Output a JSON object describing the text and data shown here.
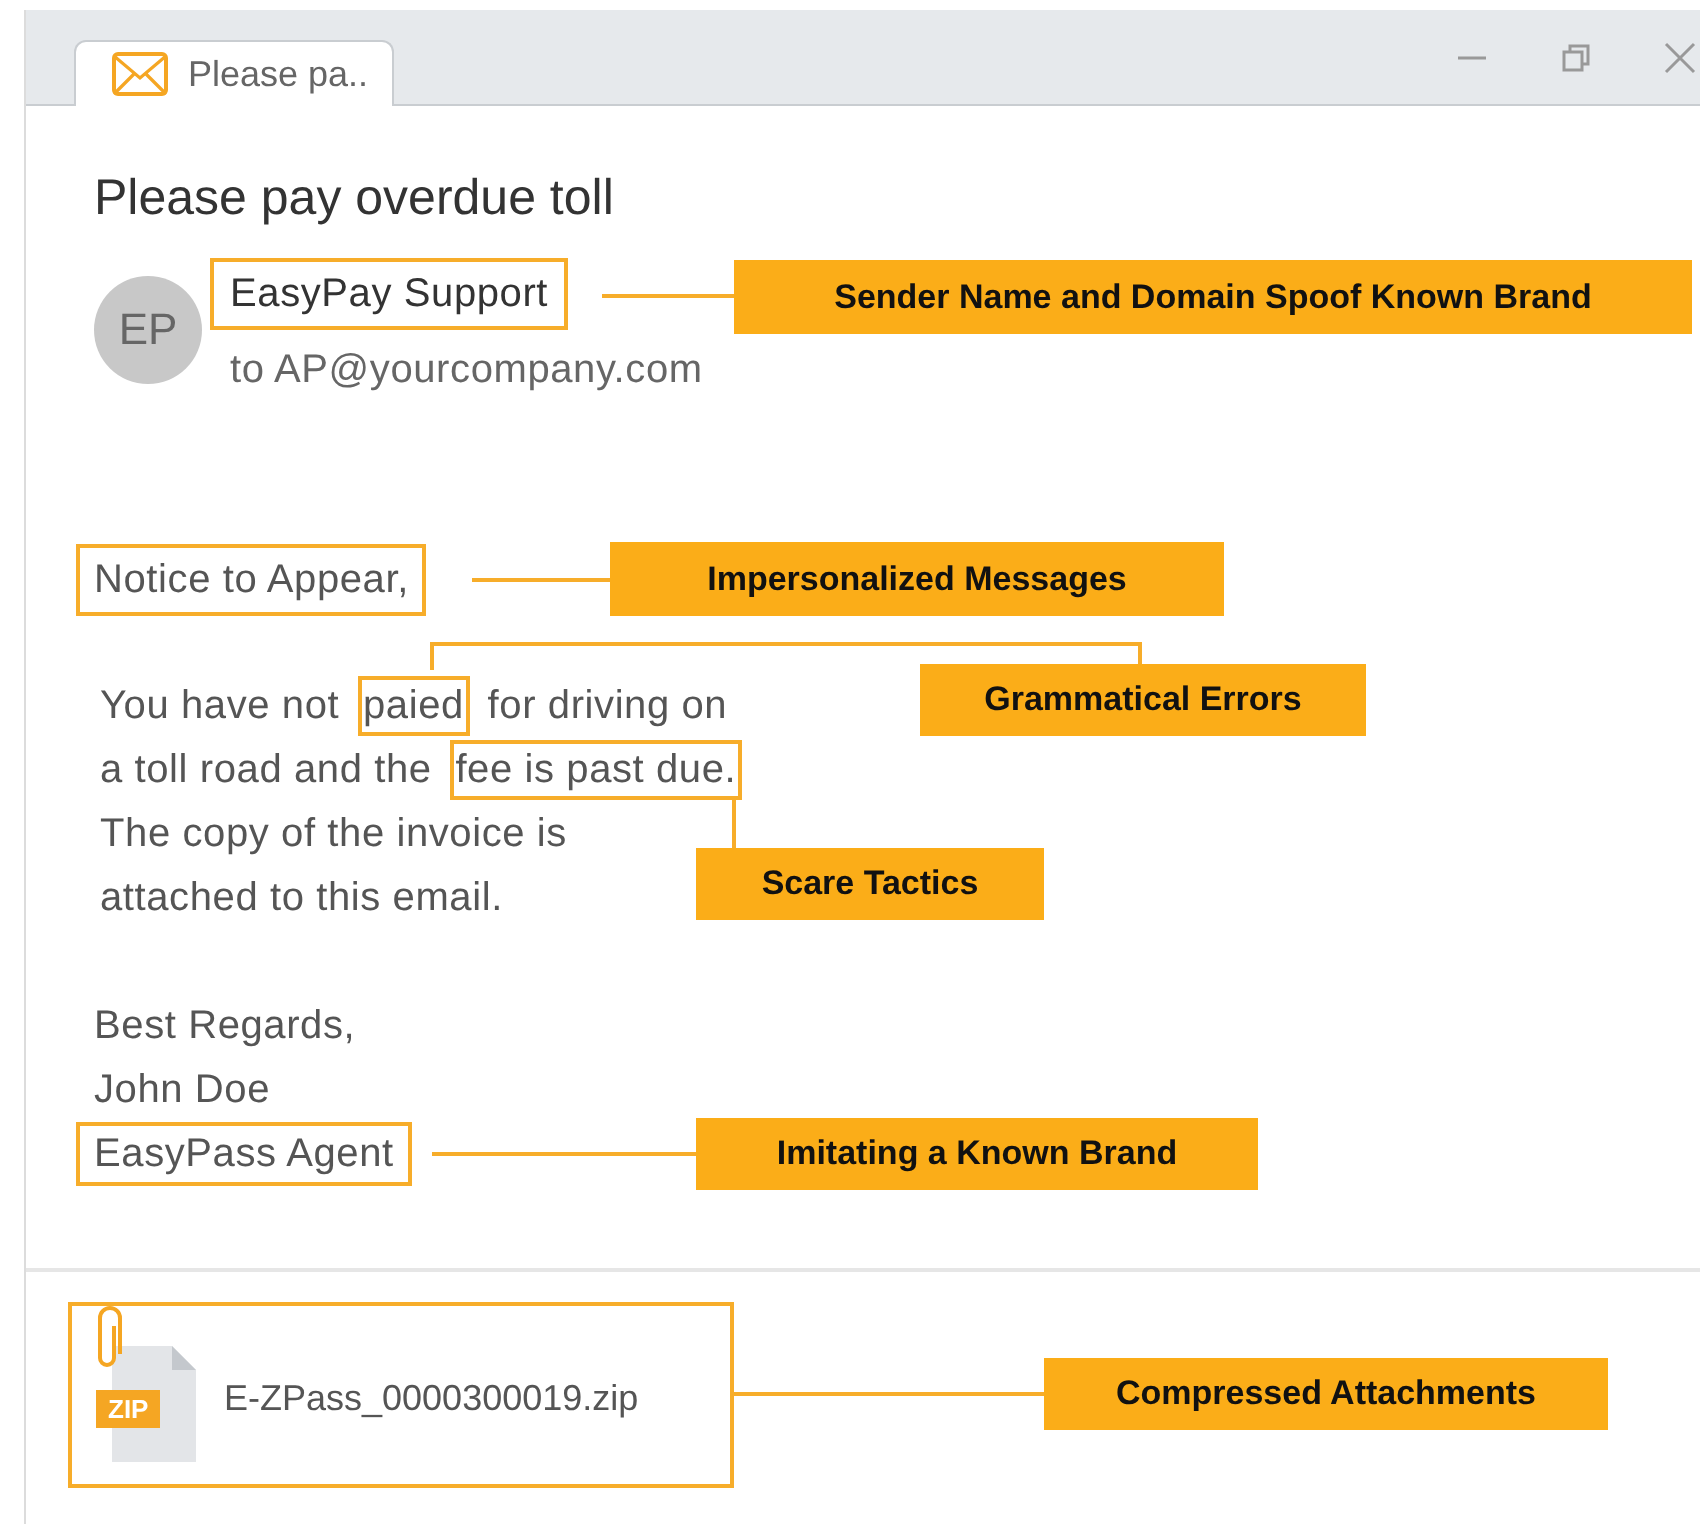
{
  "window": {
    "tab": {
      "title": "Please pa..",
      "selected": true
    }
  },
  "email": {
    "subject": "Please pay overdue toll",
    "avatar": "EP",
    "sender": {
      "text": "EasyPay Support",
      "flagged": true
    },
    "recipient": "to AP@yourcompany.com",
    "greeting": {
      "text": "Notice to Appear,",
      "flagged": true
    },
    "body_lines": [
      [
        {
          "text": "You have not ",
          "flagged": false
        },
        {
          "text": "paied",
          "flagged": true
        },
        {
          "text": " for driving on",
          "flagged": false
        }
      ],
      [
        {
          "text": "a toll road and the ",
          "flagged": false
        },
        {
          "text": "fee is past due.",
          "flagged": true
        }
      ],
      [
        {
          "text": "The copy of the invoice is",
          "flagged": false
        }
      ],
      [
        {
          "text": "attached to this email.",
          "flagged": false
        }
      ]
    ],
    "signature": [
      {
        "text": "Best Regards,",
        "flagged": false
      },
      {
        "text": "John Doe",
        "flagged": false
      },
      {
        "text": "EasyPass Agent",
        "flagged": true
      }
    ],
    "attachment": {
      "type_label": "ZIP",
      "filename": "E-ZPass_0000300019.zip",
      "flagged": true
    }
  },
  "annotations": [
    {
      "label": "Sender Name and Domain Spoof Known Brand"
    },
    {
      "label": "Impersonalized Messages"
    },
    {
      "label": "Grammatical Errors"
    },
    {
      "label": "Scare Tactics"
    },
    {
      "label": "Imitating a Known Brand"
    },
    {
      "label": "Compressed Attachments"
    }
  ]
}
